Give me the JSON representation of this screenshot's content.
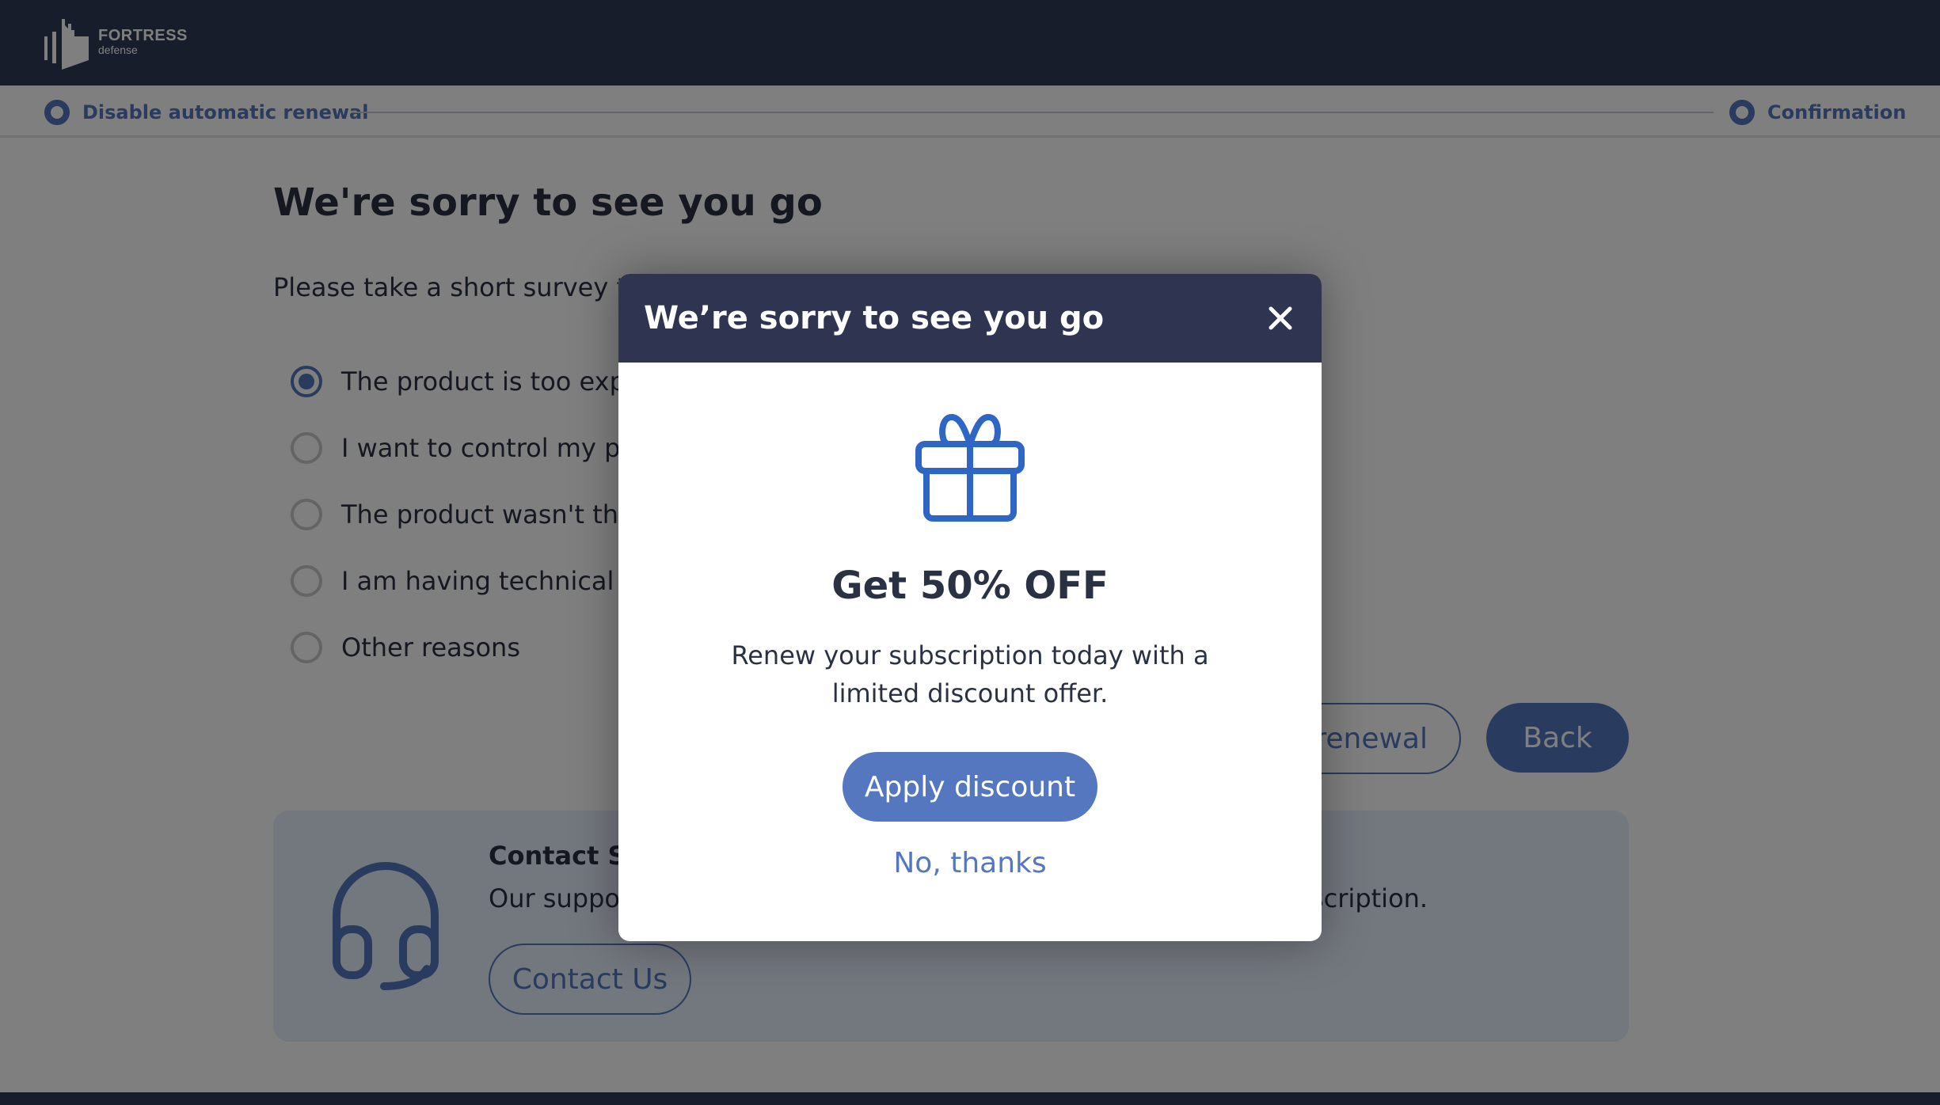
{
  "header": {
    "logo_title": "FORTRESS",
    "logo_subtitle": "defense"
  },
  "stepper": {
    "steps": [
      {
        "label": "Disable automatic renewal"
      },
      {
        "label": "Confirmation"
      }
    ]
  },
  "page": {
    "title": "We're sorry to see you go",
    "survey_intro": "Please take a short survey to",
    "options": [
      {
        "label": "The product is too expe",
        "checked": true
      },
      {
        "label": "I want to control my pay",
        "checked": false
      },
      {
        "label": "The product wasn't the",
        "checked": false
      },
      {
        "label": "I am having technical di",
        "checked": false
      },
      {
        "label": "Other reasons",
        "checked": false
      }
    ],
    "disable_renewal_button": "renewal",
    "back_button": "Back"
  },
  "support": {
    "icon": "headset-icon",
    "title": "Contact Su",
    "text_left": "Our suppor",
    "text_right": "scription.",
    "contact_button": "Contact Us"
  },
  "modal": {
    "title": "We’re sorry to see you go",
    "close_icon": "close-icon",
    "icon": "gift-icon",
    "offer_title": "Get 50% OFF",
    "offer_text": "Renew your subscription today with a limited discount offer.",
    "apply_button": "Apply discount",
    "decline_button": "No, thanks"
  },
  "colors": {
    "accent": "#5477c0",
    "header_bg": "#2f3a56",
    "modal_header_bg": "#2f3550",
    "gift_icon": "#2d66c4",
    "text": "#2a3143"
  }
}
